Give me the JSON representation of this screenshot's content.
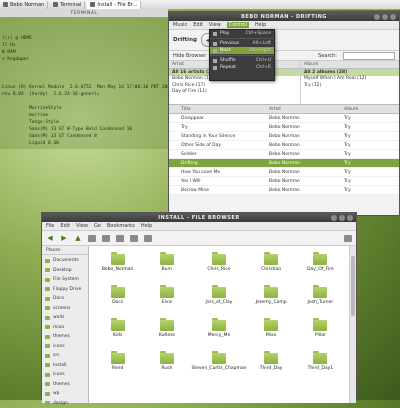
{
  "taskbar": {
    "tasks": [
      {
        "label": "Bebo Norman"
      },
      {
        "label": "Terminal"
      },
      {
        "label": "Install - File Br..."
      }
    ]
  },
  "terminal": {
    "title": "TERMINAL",
    "lines": [
      "",
      "",
      "l(r) @ HOME",
      "ll Hz",
      "B RAM",
      "o Kegdaper",
      "",
      "",
      "",
      "Linux (R) Kernel Module  2.6-6752  Mon May 14 17:08:36 PDT 2007",
      "ntu 8.04  (hardy)  2.6.24-16-generic",
      "",
      "          MurrineStyle",
      "          murrine",
      "          Tango-Style",
      "          Sans(M) 13 GT W-Type Bold Condensed 10",
      "          Sans(M) 13 GT Condensed 8",
      "          Liquid 0.38"
    ]
  },
  "player": {
    "title": "BEBO NORMAN - DRIFTING",
    "menu": [
      "Music",
      "Edit",
      "View",
      "Control",
      "Help"
    ],
    "menu_selected": "Control",
    "now_playing": "Drifting",
    "play_menu": [
      {
        "label": "Play",
        "accel": "Ctrl+Space"
      },
      {
        "label": "Previous",
        "accel": "Alt+Left"
      },
      {
        "label": "Next",
        "accel": "Alt+Right"
      },
      {
        "label": "Shuffle",
        "accel": "Ctrl+U"
      },
      {
        "label": "Repeat",
        "accel": "Ctrl+R"
      }
    ],
    "hide_browser": "Hide Browser",
    "search_label": "Search:",
    "artist_header": "Artist",
    "album_header": "Album",
    "artists": [
      "All 16 artists (272)",
      "Bebo Norman (17)",
      "Chris Rice (17)",
      "Day of Fire (11)"
    ],
    "albums": [
      "All 2 albums (28)",
      "Myself When I Am Real (12)",
      "Try (12)"
    ],
    "track_headers": [
      "",
      "Title",
      "Artist",
      "Album"
    ],
    "tracks": [
      {
        "title": "Disappear",
        "artist": "Bebo Norman",
        "album": "Try"
      },
      {
        "title": "Try",
        "artist": "Bebo Norman",
        "album": "Try"
      },
      {
        "title": "Standing in Your Silence",
        "artist": "Bebo Norman",
        "album": "Try"
      },
      {
        "title": "Other Side of Day",
        "artist": "Bebo Norman",
        "album": "Try"
      },
      {
        "title": "Soldier",
        "artist": "Bebo Norman",
        "album": "Try"
      },
      {
        "title": "Drifting",
        "artist": "Bebo Norman",
        "album": "Try"
      },
      {
        "title": "How You Love Me",
        "artist": "Bebo Norman",
        "album": "Try"
      },
      {
        "title": "Yes I Will",
        "artist": "Bebo Norman",
        "album": "Try"
      },
      {
        "title": "Borrow Mine",
        "artist": "Bebo Norman",
        "album": "Try"
      }
    ]
  },
  "files": {
    "title": "INSTALL - FILE BROWSER",
    "menu": [
      "File",
      "Edit",
      "View",
      "Go",
      "Bookmarks",
      "Help"
    ],
    "places_label": "Places",
    "sidebar": [
      "Documents",
      "Desktop",
      "File System",
      "Floppy Drive",
      "Docs",
      "screens",
      "walls",
      "mixa",
      "themes",
      "icons",
      "src",
      "Install",
      "icons",
      "themes",
      "wp",
      "design"
    ],
    "folders": [
      "Bebo_Norman",
      "Burn",
      "Chris_Rice",
      "Christian",
      "Day_Of_Fire",
      "Docs",
      "Elvis",
      "Jars_of_Clay",
      "Jeremy_Camp",
      "Josh_Turner",
      "Kids",
      "Kutless",
      "Mercy_Me",
      "Mixx",
      "Pillar",
      "Rend",
      "Rush",
      "Steven_Curtis_Chapman",
      "Third_Day",
      "Third_Day1"
    ]
  }
}
